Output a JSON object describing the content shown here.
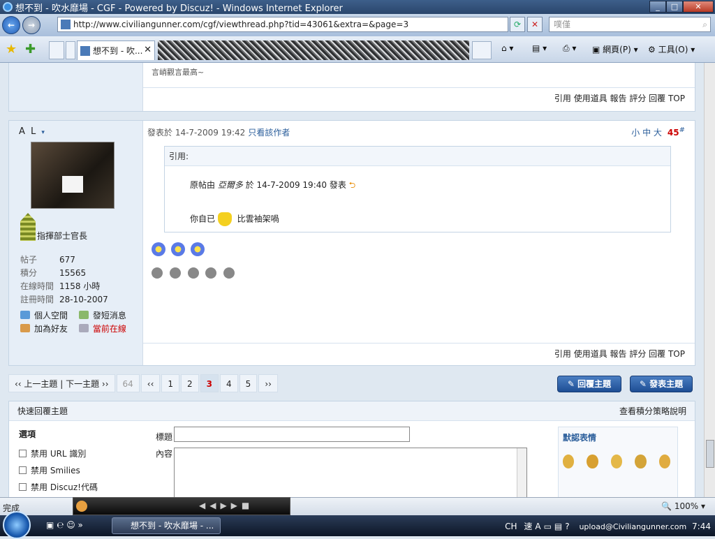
{
  "window": {
    "title": "想不到 - 吹水靡場 - CGF - Powered by Discuz! - Windows Internet Explorer"
  },
  "address": {
    "url": "http://www.civiliangunner.com/cgf/viewthread.php?tid=43061&extra=&page=3",
    "search_placeholder": "噗僅"
  },
  "tab": {
    "label": "想不到 - 吹..."
  },
  "commands": {
    "page": "網頁(P)",
    "tools": "工具(O)"
  },
  "prev_post": {
    "text_tail": "言峭觀言最高~",
    "actions": "引用 使用道具 報告 評分 回覆 TOP"
  },
  "post": {
    "username": "A L",
    "rank": "指揮部士官長",
    "stats": [
      {
        "k": "帖子",
        "v": "677"
      },
      {
        "k": "積分",
        "v": "15565"
      },
      {
        "k": "在線時間",
        "v": "1158 小時"
      },
      {
        "k": "註冊時間",
        "v": "28-10-2007"
      }
    ],
    "links": {
      "space": "個人空間",
      "pm": "發短消息",
      "friend": "加為好友",
      "online": "當前在線"
    },
    "meta": "發表於 14-7-2009 19:42",
    "only_author": "只看該作者",
    "sizes": "小 中 大",
    "floor": "45",
    "quote": {
      "header": "引用:",
      "line1_prefix": "原帖由",
      "author": "亞爾多",
      "line1_suffix": "於 14-7-2009 19:40 發表",
      "line2_a": "你自已",
      "line2_b": "比雲袖架喎"
    },
    "actions": "引用 使用道具 報告 評分 回覆 TOP"
  },
  "pager": {
    "prev_next": "‹‹ 上一主題 | 下一主題 ››",
    "total": "64",
    "first": "‹‹",
    "pages": [
      "1",
      "2",
      "3",
      "4",
      "5"
    ],
    "current": "3",
    "last": "››"
  },
  "buttons": {
    "reply": "回覆主題",
    "new_thread": "發表主題"
  },
  "quick_reply": {
    "title": "快速回覆主題",
    "points_link": "查看積分策略說明",
    "options_label": "選項",
    "options": [
      "禁用 URL 識別",
      "禁用 Smilies",
      "禁用 Discuz!代碼"
    ],
    "subject_label": "標題",
    "content_label": "內容",
    "emoticons": "默認表情"
  },
  "status": {
    "text": "完成",
    "zoom": "100%"
  },
  "taskbar": {
    "task": "想不到 - 吹水靡場 - ...",
    "lang": "CH",
    "time": "7:44",
    "tray_text": "upload@Civiliangunner.com"
  }
}
